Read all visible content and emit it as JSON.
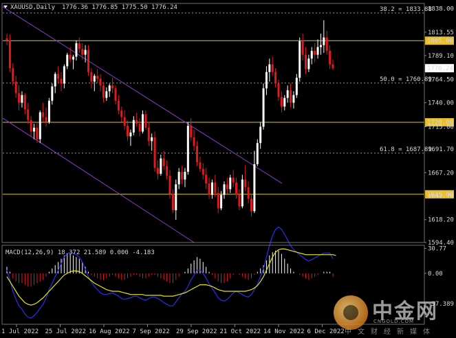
{
  "header": {
    "symbol": "XAUUSD,Daily",
    "ohlc": "1776.36 1776.85 1775.50 1776.24"
  },
  "macd": {
    "label": "MACD(12,26,9) 18.372 21.589 0.000 -4.183",
    "axis_labels": [
      "30.77",
      "0.00",
      "-37.389"
    ]
  },
  "price_axis": {
    "ticks": [
      "1838.00",
      "1813.55",
      "1789.10",
      "1764.50",
      "1740.00",
      "1715.00",
      "1691.70",
      "1667.20",
      "1642.70",
      "1618.20",
      "1594.40"
    ],
    "current_price": "1776.24"
  },
  "date_axis": [
    "1 Jul 2022",
    "25 Jul 2022",
    "16 Aug 2022",
    "7 Sep 2022",
    "29 Sep 2022",
    "21 Oct 2022",
    "14 Nov 2022",
    "6 Dec 2022"
  ],
  "levels": [
    {
      "text": "38.2 = 1833.88",
      "price": 1833.88,
      "style": "fib"
    },
    {
      "text": "1805.00",
      "price": 1805.0,
      "style": "support"
    },
    {
      "text": "50.0 = 1760.89",
      "price": 1760.89,
      "style": "fib"
    },
    {
      "text": "1720.00",
      "price": 1720.0,
      "style": "support"
    },
    {
      "text": "61.8 = 1687.89",
      "price": 1687.89,
      "style": "fib"
    },
    {
      "text": "1645.00",
      "price": 1645.0,
      "style": "support"
    }
  ],
  "watermark": {
    "brand": "中金网",
    "url": "CNGOLD.COM",
    "sub": "中文财经新媒体"
  },
  "colors": {
    "background": "#000000",
    "bull": "#ffffff",
    "bear": "#e31a1a",
    "support_line": "#d8c447",
    "fib_line": "#9a9a9a",
    "channel": "#8a3ad1",
    "macd_signal": "#e6e600",
    "macd_main": "#2d2df0"
  },
  "chart_data": {
    "type": "candlestick",
    "title": "XAUUSD,Daily",
    "y_range": [
      1594.4,
      1842.0
    ],
    "bars": [
      [
        1807,
        1812,
        1800,
        1805
      ],
      [
        1805,
        1811,
        1772,
        1776
      ],
      [
        1776,
        1781,
        1758,
        1762
      ],
      [
        1762,
        1768,
        1745,
        1750
      ],
      [
        1750,
        1758,
        1732,
        1740
      ],
      [
        1740,
        1752,
        1735,
        1748
      ],
      [
        1748,
        1750,
        1728,
        1733
      ],
      [
        1733,
        1740,
        1718,
        1722
      ],
      [
        1722,
        1726,
        1705,
        1710
      ],
      [
        1710,
        1718,
        1702,
        1714
      ],
      [
        1714,
        1720,
        1698,
        1702
      ],
      [
        1702,
        1732,
        1698,
        1730
      ],
      [
        1730,
        1740,
        1720,
        1725
      ],
      [
        1725,
        1735,
        1715,
        1720
      ],
      [
        1720,
        1745,
        1718,
        1742
      ],
      [
        1742,
        1760,
        1738,
        1757
      ],
      [
        1757,
        1772,
        1750,
        1770
      ],
      [
        1770,
        1778,
        1760,
        1765
      ],
      [
        1765,
        1772,
        1752,
        1760
      ],
      [
        1760,
        1780,
        1755,
        1778
      ],
      [
        1778,
        1792,
        1775,
        1790
      ],
      [
        1790,
        1798,
        1782,
        1785
      ],
      [
        1785,
        1790,
        1775,
        1788
      ],
      [
        1788,
        1805,
        1784,
        1802
      ],
      [
        1802,
        1808,
        1792,
        1796
      ],
      [
        1796,
        1802,
        1785,
        1790
      ],
      [
        1790,
        1800,
        1782,
        1795
      ],
      [
        1795,
        1800,
        1768,
        1772
      ],
      [
        1772,
        1776,
        1755,
        1762
      ],
      [
        1762,
        1770,
        1752,
        1768
      ],
      [
        1768,
        1775,
        1760,
        1765
      ],
      [
        1765,
        1770,
        1752,
        1758
      ],
      [
        1758,
        1762,
        1740,
        1745
      ],
      [
        1745,
        1756,
        1742,
        1752
      ],
      [
        1752,
        1760,
        1746,
        1758
      ],
      [
        1758,
        1766,
        1750,
        1755
      ],
      [
        1755,
        1758,
        1738,
        1742
      ],
      [
        1742,
        1748,
        1728,
        1732
      ],
      [
        1732,
        1736,
        1720,
        1725
      ],
      [
        1725,
        1732,
        1712,
        1716
      ],
      [
        1716,
        1722,
        1700,
        1705
      ],
      [
        1705,
        1712,
        1695,
        1709
      ],
      [
        1709,
        1726,
        1706,
        1722
      ],
      [
        1722,
        1730,
        1715,
        1718
      ],
      [
        1718,
        1724,
        1705,
        1710
      ],
      [
        1710,
        1732,
        1708,
        1728
      ],
      [
        1728,
        1732,
        1712,
        1714
      ],
      [
        1714,
        1720,
        1695,
        1700
      ],
      [
        1700,
        1708,
        1690,
        1704
      ],
      [
        1704,
        1710,
        1668,
        1672
      ],
      [
        1672,
        1680,
        1660,
        1666
      ],
      [
        1666,
        1686,
        1664,
        1682
      ],
      [
        1682,
        1690,
        1670,
        1674
      ],
      [
        1674,
        1680,
        1660,
        1664
      ],
      [
        1664,
        1670,
        1640,
        1645
      ],
      [
        1645,
        1650,
        1625,
        1628
      ],
      [
        1628,
        1660,
        1618,
        1655
      ],
      [
        1655,
        1672,
        1650,
        1668
      ],
      [
        1668,
        1674,
        1655,
        1660
      ],
      [
        1660,
        1672,
        1652,
        1668
      ],
      [
        1668,
        1720,
        1665,
        1716
      ],
      [
        1716,
        1724,
        1700,
        1704
      ],
      [
        1704,
        1712,
        1690,
        1695
      ],
      [
        1695,
        1700,
        1674,
        1678
      ],
      [
        1678,
        1684,
        1668,
        1671
      ],
      [
        1671,
        1677,
        1660,
        1665
      ],
      [
        1665,
        1672,
        1650,
        1656
      ],
      [
        1656,
        1662,
        1640,
        1644
      ],
      [
        1644,
        1660,
        1640,
        1657
      ],
      [
        1657,
        1665,
        1642,
        1646
      ],
      [
        1646,
        1652,
        1625,
        1630
      ],
      [
        1630,
        1648,
        1628,
        1644
      ],
      [
        1644,
        1658,
        1640,
        1655
      ],
      [
        1655,
        1662,
        1645,
        1650
      ],
      [
        1650,
        1665,
        1646,
        1662
      ],
      [
        1662,
        1670,
        1652,
        1657
      ],
      [
        1657,
        1662,
        1640,
        1644
      ],
      [
        1644,
        1650,
        1628,
        1632
      ],
      [
        1632,
        1665,
        1630,
        1660
      ],
      [
        1660,
        1675,
        1648,
        1652
      ],
      [
        1652,
        1658,
        1635,
        1640
      ],
      [
        1640,
        1645,
        1622,
        1627
      ],
      [
        1627,
        1690,
        1625,
        1676
      ],
      [
        1676,
        1702,
        1674,
        1698
      ],
      [
        1698,
        1720,
        1692,
        1715
      ],
      [
        1715,
        1760,
        1712,
        1755
      ],
      [
        1755,
        1778,
        1748,
        1772
      ],
      [
        1772,
        1786,
        1762,
        1780
      ],
      [
        1780,
        1788,
        1768,
        1772
      ],
      [
        1772,
        1776,
        1756,
        1760
      ],
      [
        1760,
        1764,
        1742,
        1746
      ],
      [
        1746,
        1752,
        1730,
        1736
      ],
      [
        1736,
        1748,
        1732,
        1745
      ],
      [
        1745,
        1758,
        1740,
        1753
      ],
      [
        1753,
        1760,
        1735,
        1740
      ],
      [
        1740,
        1752,
        1734,
        1748
      ],
      [
        1748,
        1770,
        1745,
        1766
      ],
      [
        1766,
        1808,
        1762,
        1804
      ],
      [
        1804,
        1812,
        1784,
        1790
      ],
      [
        1790,
        1798,
        1770,
        1775
      ],
      [
        1775,
        1790,
        1772,
        1786
      ],
      [
        1786,
        1798,
        1780,
        1794
      ],
      [
        1794,
        1802,
        1782,
        1790
      ],
      [
        1790,
        1806,
        1786,
        1798
      ],
      [
        1798,
        1812,
        1790,
        1800
      ],
      [
        1800,
        1826,
        1792,
        1808
      ],
      [
        1808,
        1815,
        1790,
        1794
      ],
      [
        1794,
        1800,
        1775,
        1780
      ],
      [
        1780,
        1785,
        1774,
        1776
      ]
    ],
    "macd_hist": [
      8,
      2,
      -6,
      -10,
      -12,
      -12,
      -14,
      -16,
      -16,
      -14,
      -12,
      -10,
      -8,
      -4,
      2,
      6,
      10,
      14,
      18,
      22,
      24,
      24,
      22,
      20,
      18,
      14,
      8,
      2,
      -2,
      -4,
      -6,
      -8,
      -8,
      -6,
      -4,
      -2,
      -4,
      -6,
      -8,
      -8,
      -6,
      -4,
      -2,
      -2,
      -4,
      -6,
      -6,
      -4,
      -2,
      -2,
      -4,
      -6,
      -8,
      -10,
      -12,
      -12,
      -8,
      -4,
      0,
      2,
      6,
      12,
      16,
      20,
      18,
      14,
      8,
      2,
      -2,
      -6,
      -10,
      -12,
      -12,
      -10,
      -6,
      -2,
      0,
      -2,
      -4,
      -6,
      -8,
      -6,
      -2,
      2,
      6,
      10,
      16,
      22,
      26,
      28,
      28,
      24,
      18,
      12,
      6,
      2,
      0,
      -2,
      -4,
      -6,
      -8,
      -6,
      -4,
      -2,
      0,
      2,
      2,
      2,
      -4
    ],
    "macd_signal": [
      -4,
      -10,
      -16,
      -22,
      -28,
      -32,
      -36,
      -38,
      -39,
      -38,
      -36,
      -33,
      -30,
      -26,
      -22,
      -18,
      -14,
      -10,
      -6,
      -2,
      0,
      2,
      3,
      3,
      2,
      0,
      -3,
      -6,
      -9,
      -12,
      -14,
      -16,
      -18,
      -20,
      -21,
      -22,
      -22,
      -22,
      -23,
      -24,
      -25,
      -26,
      -26,
      -26,
      -26,
      -26,
      -27,
      -27,
      -27,
      -27,
      -27,
      -27,
      -28,
      -28,
      -28,
      -28,
      -27,
      -26,
      -25,
      -24,
      -22,
      -20,
      -18,
      -16,
      -14,
      -14,
      -14,
      -15,
      -16,
      -18,
      -20,
      -21,
      -22,
      -22,
      -22,
      -22,
      -22,
      -22,
      -22,
      -22,
      -21,
      -20,
      -18,
      -15,
      -10,
      -4,
      4,
      12,
      20,
      26,
      29,
      30,
      30,
      29,
      28,
      27,
      26,
      25,
      24,
      23,
      23,
      23,
      23,
      23,
      23,
      23,
      23,
      23,
      23,
      22
    ],
    "macd_main": [
      4,
      -8,
      -22,
      -32,
      -40,
      -44,
      -50,
      -54,
      -55,
      -52,
      -48,
      -43,
      -38,
      -30,
      -20,
      -12,
      -4,
      4,
      12,
      20,
      24,
      26,
      25,
      23,
      20,
      14,
      5,
      -4,
      -11,
      -16,
      -20,
      -24,
      -26,
      -26,
      -25,
      -24,
      -26,
      -28,
      -31,
      -32,
      -31,
      -30,
      -28,
      -28,
      -30,
      -32,
      -33,
      -31,
      -29,
      -29,
      -31,
      -33,
      -36,
      -38,
      -40,
      -40,
      -35,
      -30,
      -25,
      -22,
      -16,
      -8,
      -2,
      4,
      4,
      0,
      -6,
      -13,
      -18,
      -24,
      -30,
      -33,
      -34,
      -32,
      -28,
      -24,
      -22,
      -24,
      -26,
      -28,
      -29,
      -26,
      -20,
      -13,
      -4,
      6,
      20,
      34,
      46,
      54,
      57,
      54,
      48,
      41,
      34,
      29,
      26,
      23,
      20,
      17,
      15,
      17,
      19,
      21,
      23,
      25,
      25,
      25,
      18
    ],
    "macd_range": [
      -60,
      32
    ],
    "channels": [
      {
        "note": "upper descending channel line",
        "points": [
          [
            "1 Jul 2022",
            1840
          ],
          [
            "14 Nov 2022",
            1656
          ]
        ]
      },
      {
        "note": "lower descending channel line",
        "points": [
          [
            "1 Jul 2022",
            1724
          ],
          [
            "29 Sep 2022",
            1594
          ]
        ]
      }
    ]
  }
}
